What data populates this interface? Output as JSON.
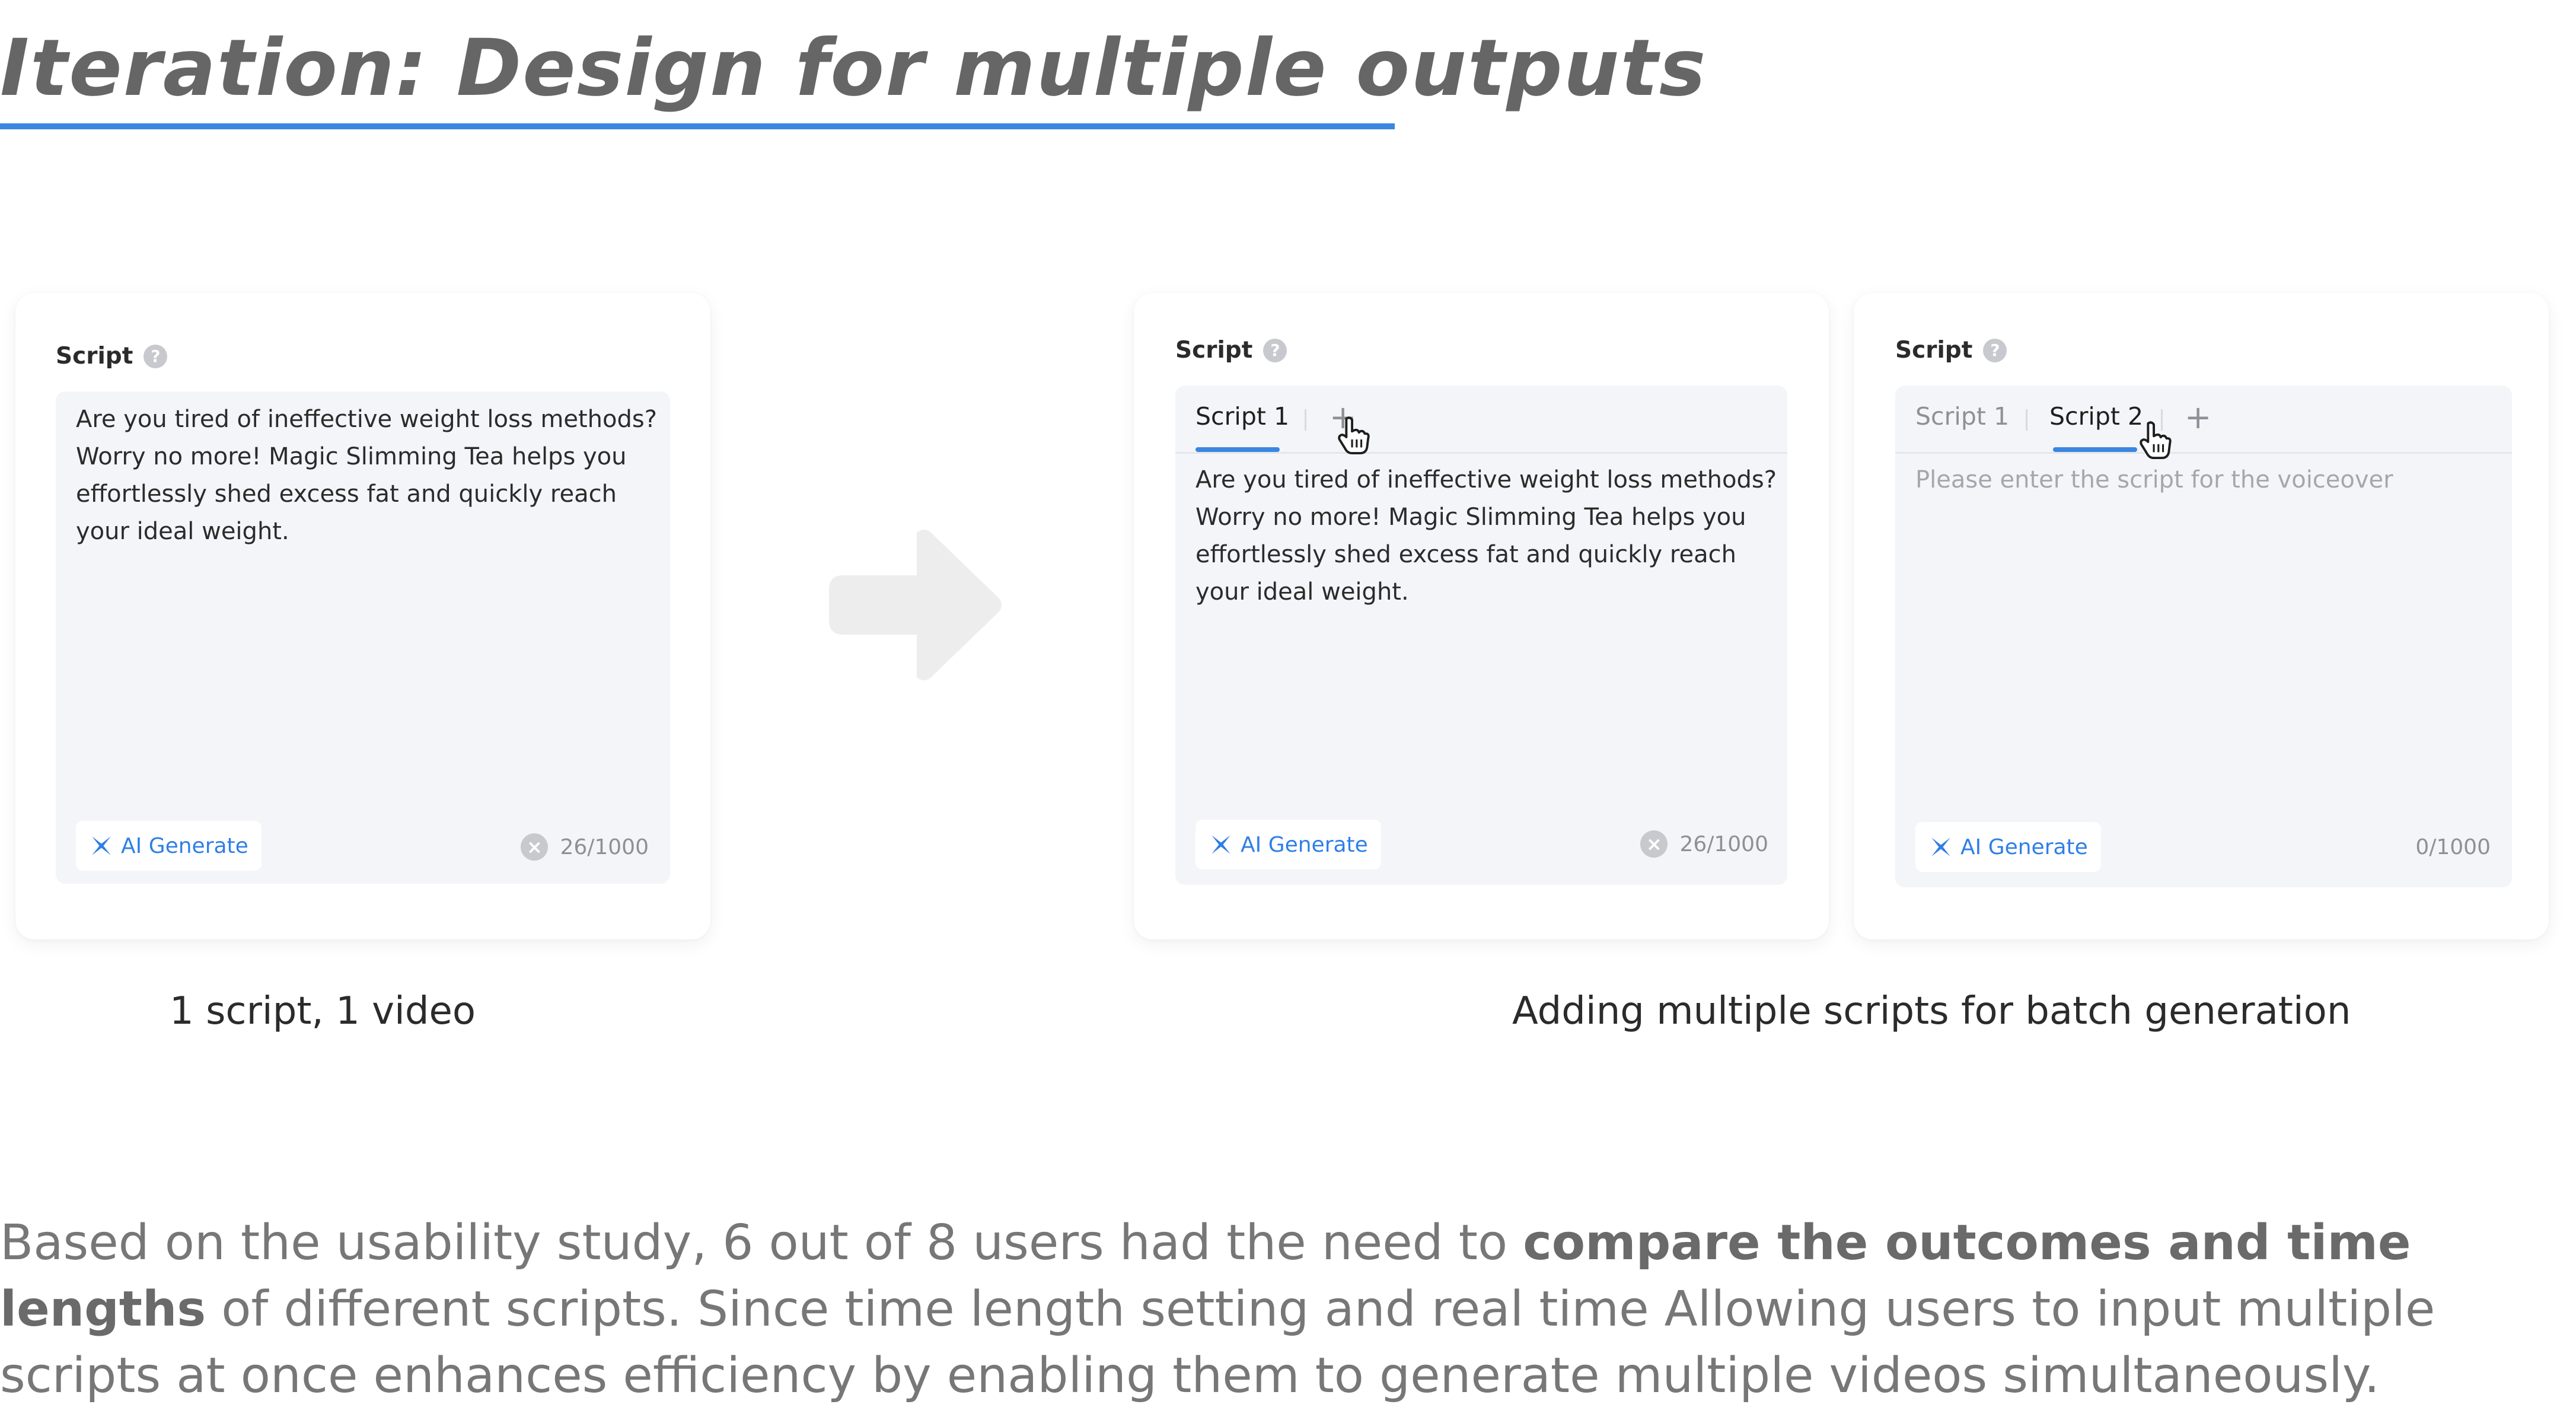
{
  "page": {
    "title": "Iteration: Design for multiple outputs",
    "accent_color": "#3a86e0"
  },
  "card_single": {
    "header": "Script",
    "help_icon": "question-circle-icon",
    "script_text": "Are you tired of ineffective weight loss methods? Worry no more! Magic Slimming Tea helps you effortlessly shed excess fat and quickly reach your ideal weight.",
    "ai_button_label": "AI Generate",
    "ai_button_icon": "sparkle-icon",
    "counter": "26/1000",
    "clear_icon": "clear-icon"
  },
  "card_tab1": {
    "header": "Script",
    "tabs": [
      {
        "label": "Script 1",
        "active": true
      }
    ],
    "add_tab_label": "+",
    "cursor": "hand-pointer-icon",
    "script_text": "Are you tired of ineffective weight loss methods? Worry no more! Magic Slimming Tea helps you effortlessly shed excess fat and quickly reach your ideal weight.",
    "ai_button_label": "AI Generate",
    "counter": "26/1000"
  },
  "card_tab2": {
    "header": "Script",
    "tabs": [
      {
        "label": "Script 1",
        "active": false
      },
      {
        "label": "Script 2",
        "active": true
      }
    ],
    "add_tab_label": "+",
    "cursor": "hand-pointer-icon",
    "placeholder": "Please enter the script for the voiceover",
    "ai_button_label": "AI Generate",
    "counter": "0/1000"
  },
  "transition_arrow": "right-arrow-icon",
  "captions": {
    "left": "1 script, 1 video",
    "right": "Adding multiple scripts for batch generation"
  },
  "description": {
    "part1": "Based on the usability study, 6 out of 8 users had the need to ",
    "emphasis": "compare the outcomes and time lengths",
    "part2": " of different scripts. Since time length setting and real time Allowing users to input multiple scripts at once enhances efficiency by enabling them to generate multiple videos simultaneously."
  }
}
